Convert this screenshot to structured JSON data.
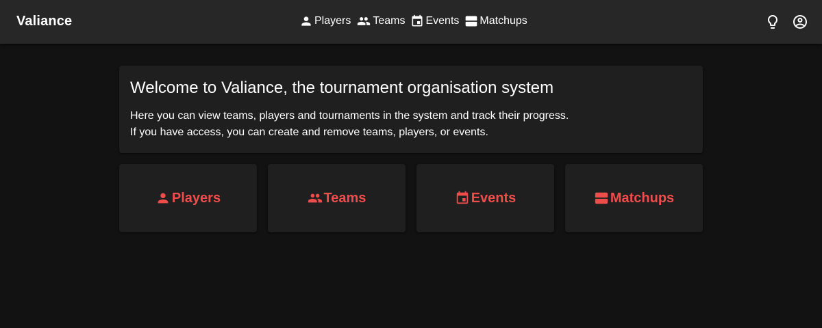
{
  "app": {
    "title": "Valiance"
  },
  "nav": {
    "items": [
      {
        "label": "Players",
        "icon": "person-icon"
      },
      {
        "label": "Teams",
        "icon": "group-icon"
      },
      {
        "label": "Events",
        "icon": "calendar-icon"
      },
      {
        "label": "Matchups",
        "icon": "matchups-icon"
      }
    ]
  },
  "actions": {
    "theme_icon": "lightbulb-icon",
    "account_icon": "account-circle-icon"
  },
  "welcome": {
    "heading": "Welcome to Valiance, the tournament organisation system",
    "line1": "Here you can view teams, players and tournaments in the system and track their progress.",
    "line2": "If you have access, you can create and remove teams, players, or events."
  },
  "cards": [
    {
      "label": "Players",
      "icon": "person-icon"
    },
    {
      "label": "Teams",
      "icon": "group-icon"
    },
    {
      "label": "Events",
      "icon": "calendar-icon"
    },
    {
      "label": "Matchups",
      "icon": "matchups-icon"
    }
  ],
  "colors": {
    "accent": "#ef4c4c",
    "appbar": "#272727",
    "background": "#121212",
    "card": "#1f1f1f"
  }
}
